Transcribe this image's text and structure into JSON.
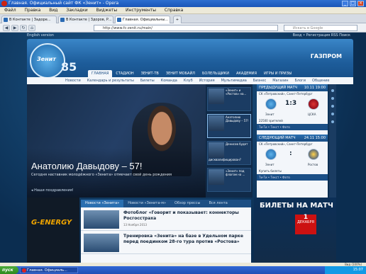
{
  "window": {
    "title": "Главная. Официальный сайт ФК «Зенит» - Opera"
  },
  "menu": [
    "Файл",
    "Правка",
    "Вид",
    "Закладки",
    "Виджеты",
    "Инструменты",
    "Справка"
  ],
  "tabs": [
    {
      "label": "В Контакте | Задоре..."
    },
    {
      "label": "В Контакте | Здоров, Р..."
    },
    {
      "label": "Главная. Официальны..."
    }
  ],
  "address": {
    "url": "http://www.fc-zenit.ru/main/",
    "search_placeholder": "Искать в Google"
  },
  "site": {
    "top_strip": "English version",
    "top_right": "Вход  •  Регистрация  RSS   Поиск",
    "logo_text": "Зенит",
    "anniv": "85",
    "sponsor": "ГАЗПРОМ",
    "main_nav": [
      "ГЛАВНАЯ",
      "СТАДИОН",
      "ЗЕНИТ-ТВ",
      "ЗЕНИТ МОБАЙЛ",
      "БОЛЕЛЬЩИКИ",
      "АКАДЕМИЯ",
      "ИГРЫ И ПРИЗЫ"
    ],
    "sub_nav": [
      "Новости",
      "Календарь и результаты",
      "Билеты",
      "Команда",
      "Клуб",
      "История",
      "Мультимедиа",
      "Бизнес",
      "Магазин",
      "Блоги",
      "Общение"
    ],
    "hero": {
      "title": "Анатолию Давыдову – 57!",
      "subtitle": "Сегодня наставник молодёжного «Зенита» отмечает свой день рождения",
      "link": "Наши поздравления!"
    },
    "thumbs": [
      {
        "text": "«Зенит» и «Ростов» на..."
      },
      {
        "text": "Анатолию Давыдову – 57!"
      },
      {
        "text": "Денисов будет дисквалифицирован?"
      },
      {
        "text": "«Зенит» под флагом на ..."
      }
    ],
    "prev_match": {
      "header": "ПРЕДЫДУЩИЙ МАТЧ",
      "date": "10.11 19:00",
      "info": "СК «Петровский», Санкт-Петербург",
      "home": "Зенит",
      "away": "ЦСКА",
      "score": "1:3",
      "note": "22500 зрителей",
      "links": "Ти-Ти  •  Текст  •  Фото"
    },
    "next_match": {
      "header": "СЛЕДУЮЩИЙ МАТЧ",
      "date": "24.11 15:00",
      "info": "СК «Петровский», Санкт-Петербург",
      "home": "Зенит",
      "away": "Ростов",
      "score": ":",
      "note": "Купить билеты",
      "links": "Ти-Ти  •  Текст  •  Фото"
    },
    "news_tabs": [
      "Новости «Зенита»",
      "Новости «Зенита-м»",
      "Обзор прессы",
      "Вся лента"
    ],
    "news": [
      {
        "title": "Фотоблог «Говорит и показывает: коннекторы Росгосстраха",
        "date": "13 Ноября 2013"
      },
      {
        "title": "Тренировка «Зенита» на базе в Удельном парке перед поединком 28-го тура против «Ростова»",
        "date": ""
      }
    ],
    "ad_brand": "G-ENERGY",
    "tickets": {
      "title": "БИЛЕТЫ НА МАТЧ",
      "day": "1",
      "month": "ДЕКАБРЯ"
    }
  },
  "status": {
    "zoom": "Вид (100%)"
  },
  "taskbar": {
    "start": "пуск",
    "item": "Главная. Официаль...",
    "clock": "15:07"
  }
}
